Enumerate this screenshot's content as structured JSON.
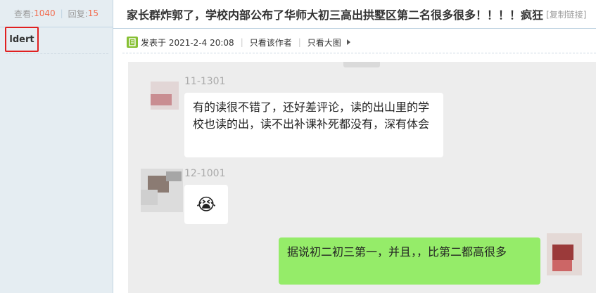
{
  "stats": {
    "views_label": "查看:",
    "views_count": "1040",
    "replies_label": "回复:",
    "replies_count": "15"
  },
  "author": {
    "name": "ldert"
  },
  "thread": {
    "title": "家长群炸郭了，学校内部公布了华师大初三高出拱墅区第二名很多很多！！！！疯狂",
    "copy_link": "[复制链接]"
  },
  "meta": {
    "posted": "发表于 2021-2-4 20:08",
    "only_author": "只看该作者",
    "big_image": "只看大图"
  },
  "chat": {
    "messages": [
      {
        "sender": "11-1301",
        "text": "有的读很不错了，还好差评论，读的出山里的学校也读的出，读不出补课补死都没有，深有体会"
      },
      {
        "sender": "12-1001",
        "text": "😭"
      },
      {
        "sender": "",
        "text": "据说初二初三第一，并且，，比第二都高很多"
      }
    ]
  },
  "colors": {
    "left_bg": "#e5edf2",
    "stat_number": "#f26c4f",
    "highlight_border": "#e02020",
    "chat_bg": "#ededed",
    "self_bubble": "#95ec69",
    "post_icon": "#87c034"
  },
  "icons": {
    "post": "post-icon",
    "arrow": "arrow-right-icon"
  }
}
